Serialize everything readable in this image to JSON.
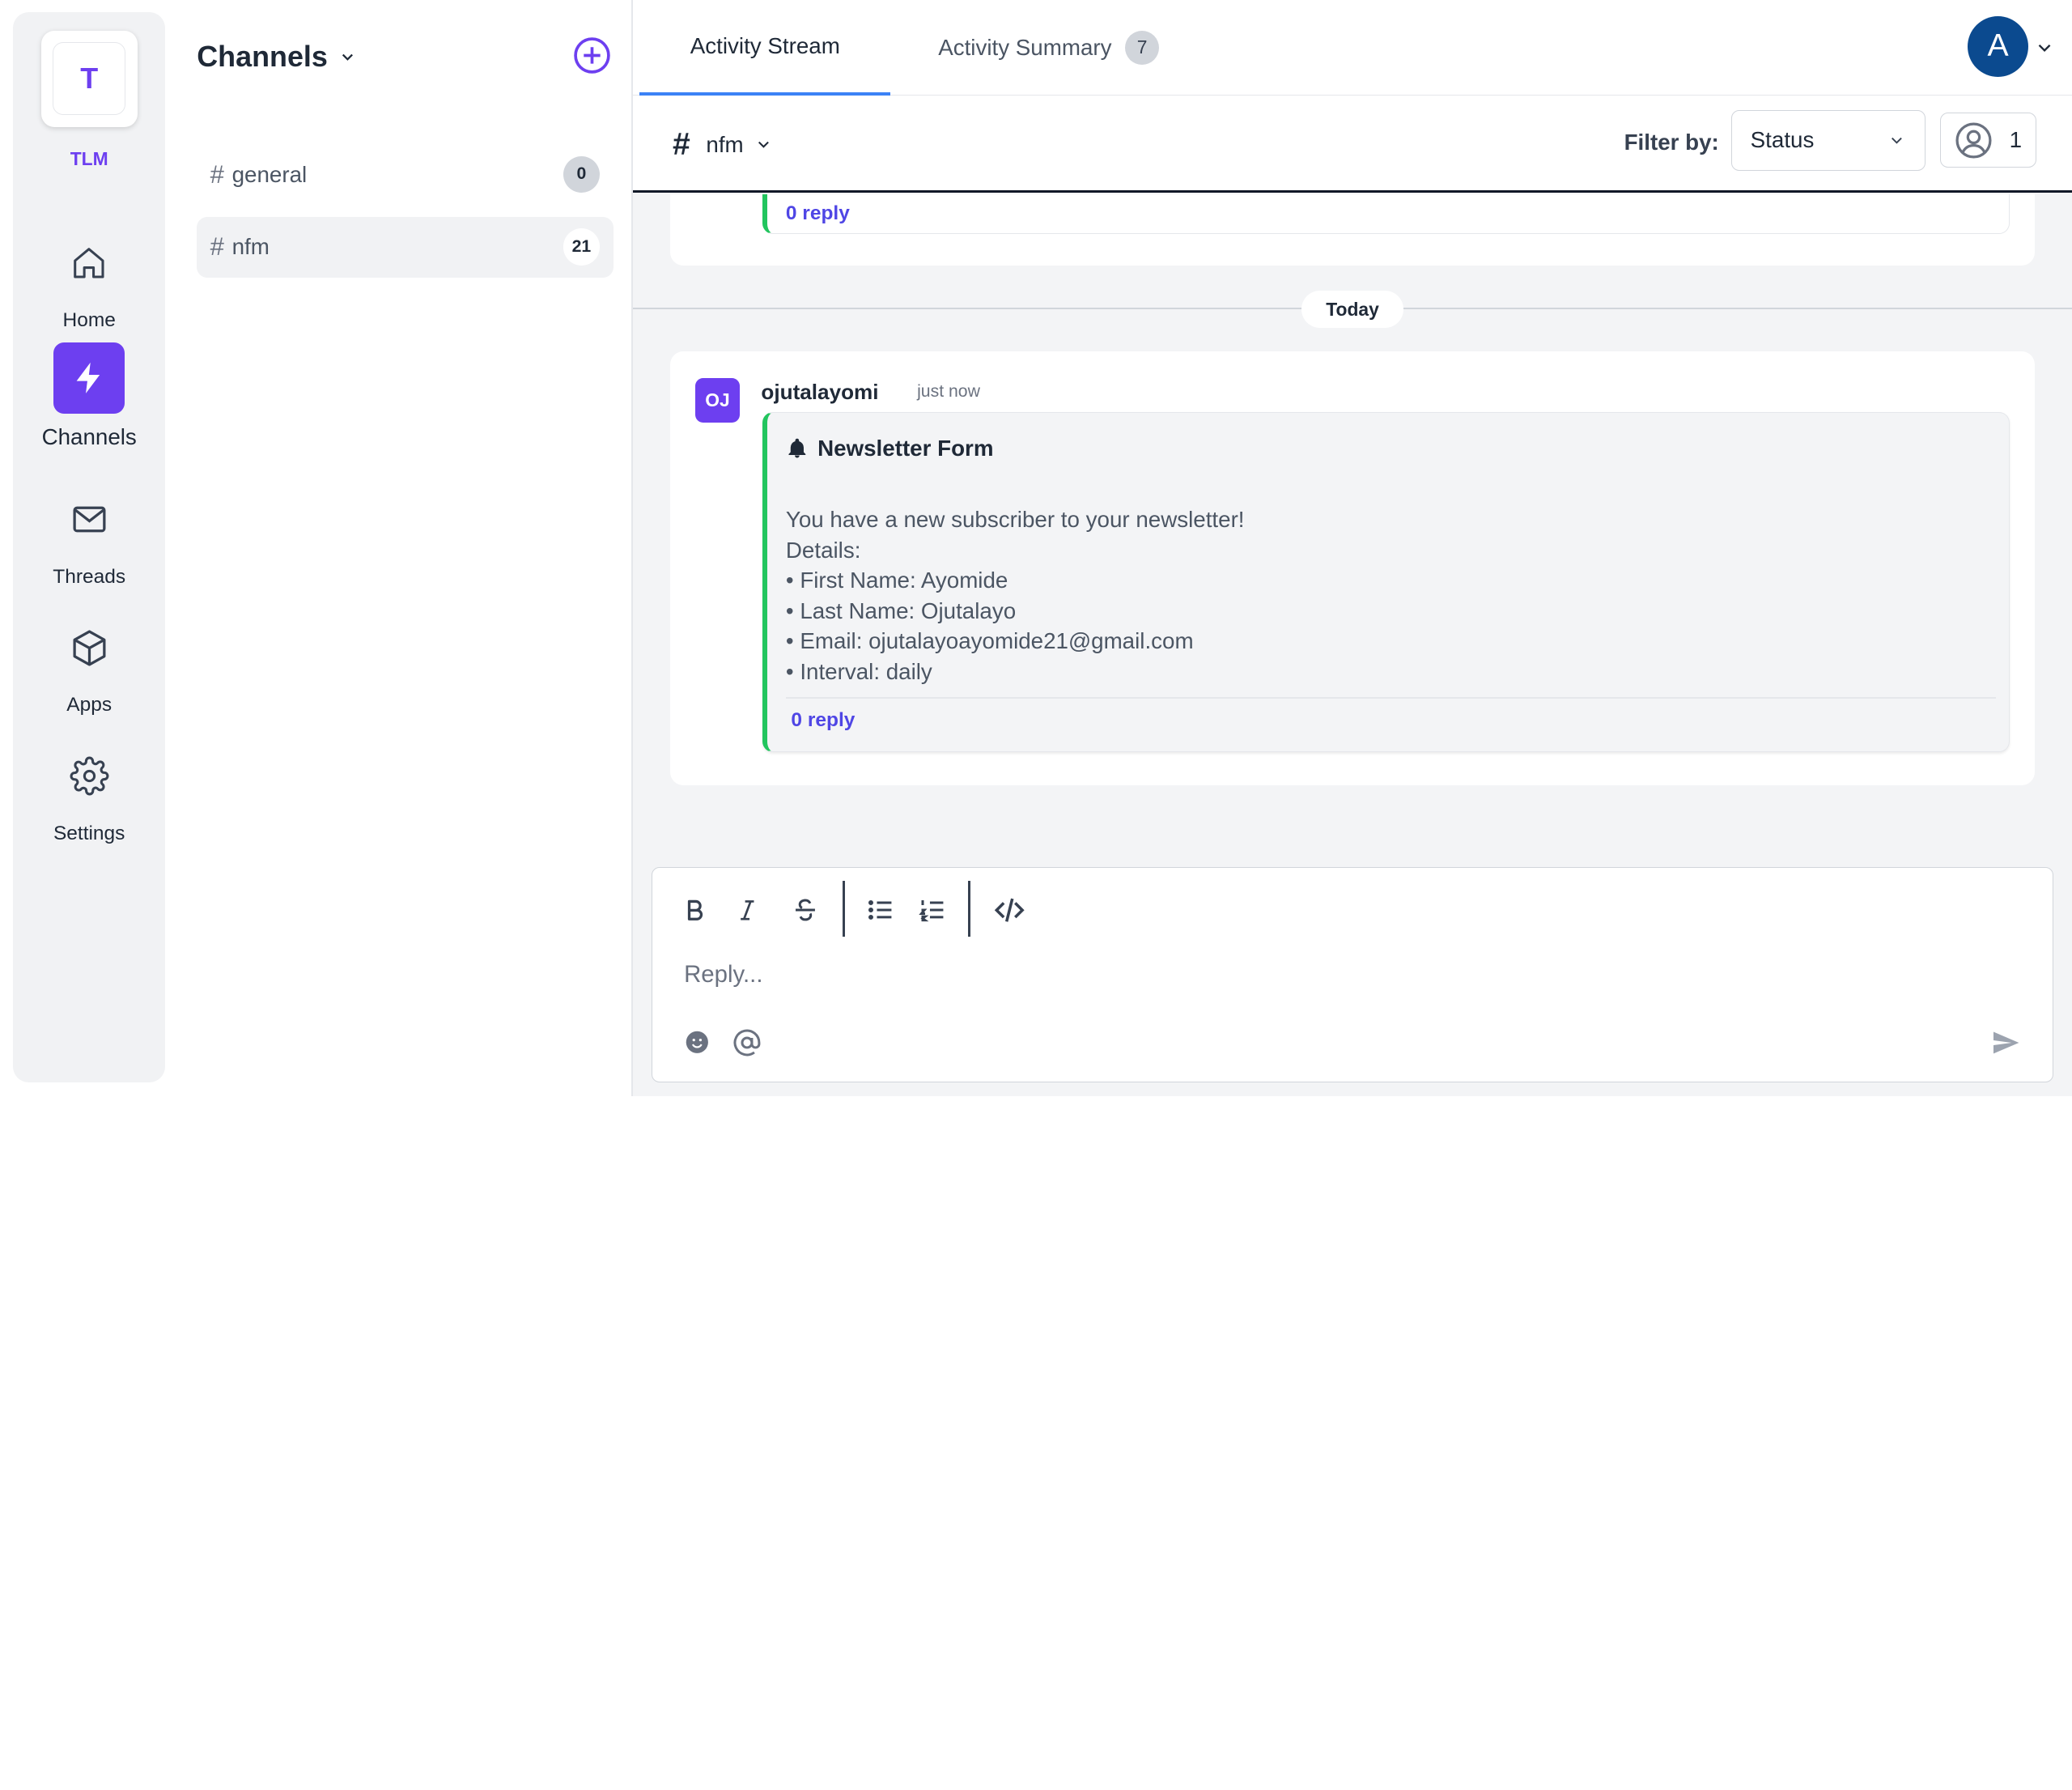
{
  "workspace": {
    "initial": "T",
    "name": "TLM"
  },
  "nav": {
    "home": "Home",
    "channels": "Channels",
    "threads": "Threads",
    "apps": "Apps",
    "settings": "Settings"
  },
  "channels_panel": {
    "title": "Channels",
    "items": [
      {
        "hash": "#",
        "name": "general",
        "count": "0"
      },
      {
        "hash": "#",
        "name": "nfm",
        "count": "21"
      }
    ]
  },
  "tabs": {
    "stream": "Activity Stream",
    "summary": "Activity Summary",
    "summary_count": "7"
  },
  "user": {
    "initial": "A"
  },
  "subbar": {
    "hash": "#",
    "channel": "nfm",
    "filter_label": "Filter by:",
    "filter_value": "Status",
    "member_count": "1"
  },
  "feed": {
    "previous_reply": "0 reply",
    "date_divider": "Today",
    "message": {
      "avatar": "OJ",
      "author": "ojutalayomi",
      "time": "just now",
      "title": "Newsletter Form",
      "lines": [
        "You have a new subscriber to your newsletter!",
        "Details:",
        "• First Name: Ayomide",
        "• Last Name: Ojutalayo",
        "• Email: ojutalayoayomide21@gmail.com",
        "• Interval: daily"
      ],
      "reply": "0 reply"
    }
  },
  "composer": {
    "placeholder": "Reply..."
  },
  "colors": {
    "accent": "#6d3ff0",
    "green_bar": "#22c55e",
    "link": "#4f46e5",
    "avatar_user": "#0b4a8f"
  }
}
